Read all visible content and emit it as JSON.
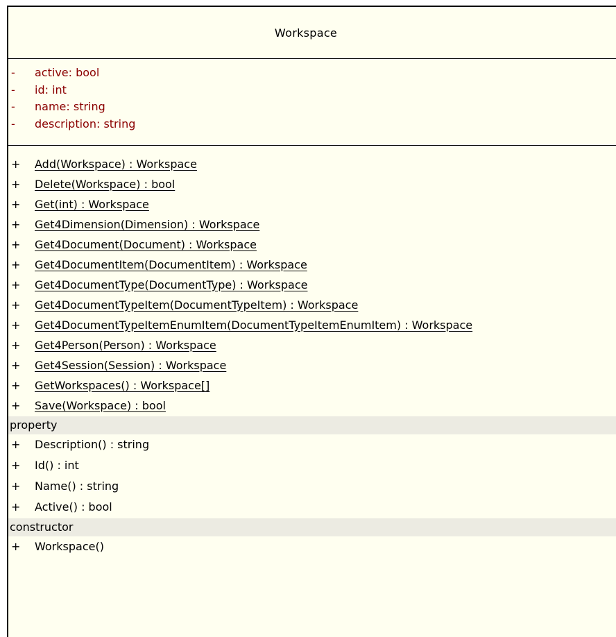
{
  "class_name": "Workspace",
  "colors": {
    "background": "#fffff0",
    "attribute_text": "#8b0000",
    "section_band": "#ecebe2"
  },
  "attributes": [
    {
      "visibility": "-",
      "text": "active: bool"
    },
    {
      "visibility": "-",
      "text": "id: int"
    },
    {
      "visibility": "-",
      "text": "name: string"
    },
    {
      "visibility": "-",
      "text": "description: string"
    }
  ],
  "operations": [
    {
      "visibility": "+",
      "text": "Add(Workspace) : Workspace"
    },
    {
      "visibility": "+",
      "text": "Delete(Workspace) : bool"
    },
    {
      "visibility": "+",
      "text": "Get(int) : Workspace"
    },
    {
      "visibility": "+",
      "text": "Get4Dimension(Dimension) : Workspace"
    },
    {
      "visibility": "+",
      "text": "Get4Document(Document) : Workspace"
    },
    {
      "visibility": "+",
      "text": "Get4DocumentItem(DocumentItem) : Workspace"
    },
    {
      "visibility": "+",
      "text": "Get4DocumentType(DocumentType) : Workspace"
    },
    {
      "visibility": "+",
      "text": "Get4DocumentTypeItem(DocumentTypeItem) : Workspace"
    },
    {
      "visibility": "+",
      "text": "Get4DocumentTypeItemEnumItem(DocumentTypeItemEnumItem) : Workspace"
    },
    {
      "visibility": "+",
      "text": "Get4Person(Person) : Workspace"
    },
    {
      "visibility": "+",
      "text": "Get4Session(Session) : Workspace"
    },
    {
      "visibility": "+",
      "text": "GetWorkspaces() : Workspace[]"
    },
    {
      "visibility": "+",
      "text": "Save(Workspace) : bool"
    }
  ],
  "property_section": {
    "title": "property",
    "items": [
      {
        "visibility": "+",
        "text": "Description() : string"
      },
      {
        "visibility": "+",
        "text": "Id() : int"
      },
      {
        "visibility": "+",
        "text": "Name() : string"
      },
      {
        "visibility": "+",
        "text": "Active() : bool"
      }
    ]
  },
  "constructor_section": {
    "title": "constructor",
    "items": [
      {
        "visibility": "+",
        "text": "Workspace()"
      }
    ]
  }
}
